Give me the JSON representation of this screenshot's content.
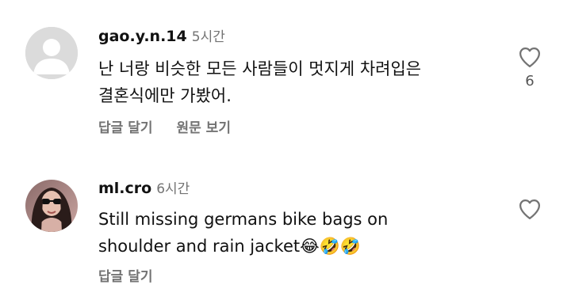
{
  "comments": [
    {
      "username": "gao.y.n.14",
      "time": "5시간",
      "lines": [
        "난 너랑 비슷한 모든 사람들이 멋지게 차려입은",
        "결혼식에만 가봤어."
      ],
      "reply_label": "답글 달기",
      "translate_label": "원문 보기",
      "like_count": "6",
      "avatar_icon": "default-avatar-icon"
    },
    {
      "username": "ml.cro",
      "time": "6시간",
      "lines": [
        "Still missing germans bike bags on",
        "shoulder and rain jacket😂🤣🤣"
      ],
      "reply_label": "답글 달기",
      "avatar_icon": "profile-photo"
    }
  ],
  "colors": {
    "text": "#111111",
    "secondary": "#737373",
    "avatar_placeholder_bg": "#dbdbdb"
  }
}
